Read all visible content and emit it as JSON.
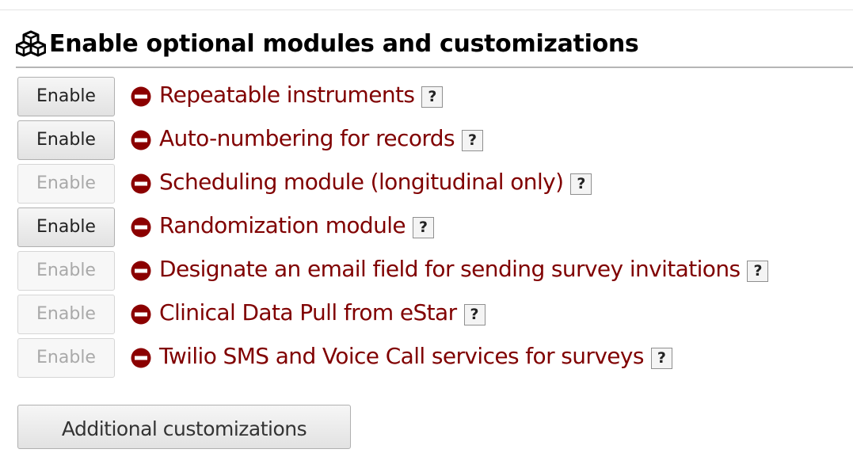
{
  "section": {
    "title": "Enable optional modules and customizations",
    "icon": "cubes-icon"
  },
  "modules": [
    {
      "button_label": "Enable",
      "button_enabled": true,
      "status_icon": "minus-circle-icon",
      "label": "Repeatable instruments",
      "help_label": "?"
    },
    {
      "button_label": "Enable",
      "button_enabled": true,
      "status_icon": "minus-circle-icon",
      "label": "Auto-numbering for records",
      "help_label": "?"
    },
    {
      "button_label": "Enable",
      "button_enabled": false,
      "status_icon": "minus-circle-icon",
      "label": "Scheduling module (longitudinal only)",
      "help_label": "?"
    },
    {
      "button_label": "Enable",
      "button_enabled": true,
      "status_icon": "minus-circle-icon",
      "label": "Randomization module",
      "help_label": "?"
    },
    {
      "button_label": "Enable",
      "button_enabled": false,
      "status_icon": "minus-circle-icon",
      "label": "Designate an email field for sending survey invitations",
      "help_label": "?"
    },
    {
      "button_label": "Enable",
      "button_enabled": false,
      "status_icon": "minus-circle-icon",
      "label": "Clinical Data Pull from eStar",
      "help_label": "?"
    },
    {
      "button_label": "Enable",
      "button_enabled": false,
      "status_icon": "minus-circle-icon",
      "label": "Twilio SMS and Voice Call services for surveys",
      "help_label": "?"
    }
  ],
  "additional_customizations_label": "Additional customizations",
  "colors": {
    "module_label": "#800000",
    "status_icon": "#8b0000",
    "title": "#000000"
  }
}
